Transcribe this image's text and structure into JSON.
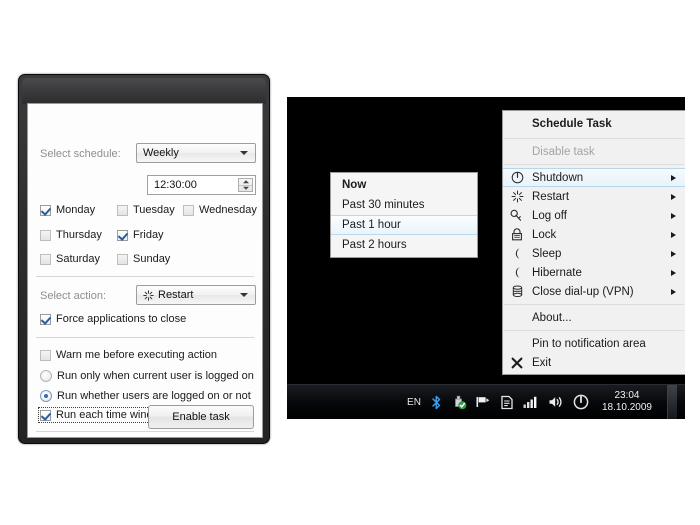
{
  "dialog": {
    "schedule_label": "Select schedule:",
    "schedule_value": "Weekly",
    "time_value": "12:30:00",
    "days": [
      {
        "label": "Monday",
        "checked": true
      },
      {
        "label": "Tuesday",
        "checked": false
      },
      {
        "label": "Wednesday",
        "checked": false
      },
      {
        "label": "Thursday",
        "checked": false
      },
      {
        "label": "Friday",
        "checked": true
      },
      {
        "label": "Saturday",
        "checked": false
      },
      {
        "label": "Sunday",
        "checked": false
      }
    ],
    "action_label": "Select action:",
    "action_value": "Restart",
    "force_close_label": "Force applications to close",
    "warn_label": "Warn me before executing action",
    "radio_current_user": "Run only when current user is logged on",
    "radio_any_user": "Run whether users are logged on or not",
    "run_each_start_label": "Run each time windows starts",
    "enable_button": "Enable task"
  },
  "main_menu": {
    "header": "Schedule Task",
    "disable_task": "Disable task",
    "items": [
      {
        "label": "Shutdown",
        "icon": "power-icon",
        "submenu": true
      },
      {
        "label": "Restart",
        "icon": "restart-icon",
        "submenu": true
      },
      {
        "label": "Log off",
        "icon": "key-icon",
        "submenu": true
      },
      {
        "label": "Lock",
        "icon": "lock-icon",
        "submenu": true
      },
      {
        "label": "Sleep",
        "icon": "moon-icon",
        "submenu": true
      },
      {
        "label": "Hibernate",
        "icon": "moon-icon",
        "submenu": true
      },
      {
        "label": "Close dial-up (VPN)",
        "icon": "network-icon",
        "submenu": true
      }
    ],
    "about": "About...",
    "pin": "Pin to notification area",
    "exit": "Exit"
  },
  "sub_menu": {
    "items": [
      {
        "label": "Now",
        "bold": true,
        "highlighted": false
      },
      {
        "label": "Past 30 minutes",
        "bold": false,
        "highlighted": false
      },
      {
        "label": "Past 1 hour",
        "bold": false,
        "highlighted": true
      },
      {
        "label": "Past 2 hours",
        "bold": false,
        "highlighted": false
      }
    ]
  },
  "taskbar": {
    "language": "EN",
    "time": "23:04",
    "date": "18.10.2009",
    "icons": [
      "bluetooth-icon",
      "usb-safe-remove-icon",
      "flag-icon",
      "document-icon",
      "signal-bars-icon",
      "speaker-icon",
      "power-icon"
    ]
  },
  "colors": {
    "accent_blue": "#2f6fb5",
    "highlight": "#e8f3fb",
    "menu_bg": "#f1f1f1",
    "taskbar_bg": "#000000"
  }
}
